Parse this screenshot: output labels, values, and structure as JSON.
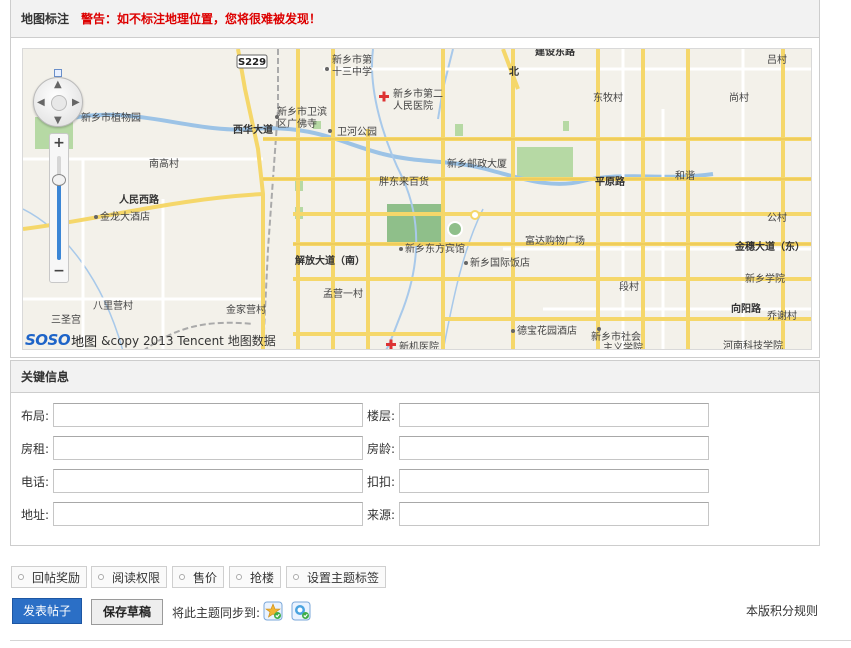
{
  "map_section": {
    "title": "地图标注",
    "warning": "警告：如不标注地理位置，您将很难被发现！",
    "logo_brand": "SOSO",
    "logo_suffix": "地图",
    "copyright": "&copy 2013 Tencent 地图数据",
    "labels": {
      "s229": "S229",
      "xinxiang_13": "新乡市第十三中学",
      "xinxiang_13_line1": "新乡市第",
      "xinxiang_13_line2": "十三中学",
      "hospital2_line1": "新乡市第二",
      "hospital2_line2": "人民医院",
      "jianshe_road": "建设东路",
      "bei": "北",
      "lv_cun": "吕村",
      "zhiwuyuan": "新乡市植物园",
      "weibin_line1": "新乡市卫滨",
      "weibin_line2": "区广佛寺",
      "weihe_park": "卫河公园",
      "dongmu": "东牧村",
      "shang_cun": "尚村",
      "nangao": "南高村",
      "xihua_dadao": "西华大道",
      "post_building": "新乡邮政大厦",
      "pangdonglai": "胖东来百货",
      "pingyuan_road": "平原路",
      "hexie": "和谐",
      "renmin_road": "人民西路",
      "jinlong_hotel": "金龙大酒店",
      "gong_cun": "公村",
      "fuda": "富达购物广场",
      "dongfang_hotel": "新乡东方宾馆",
      "jinsui_road": "金穗大道（东）",
      "guoji_hotel": "新乡国际饭店",
      "jiefang_dadao": "解放大道（南）",
      "xinxiang_college": "新乡学院",
      "duan_cun": "段村",
      "baying": "八里营村",
      "jinjia": "金家营村",
      "mengying": "孟营一村",
      "xiangyang_road": "向阳路",
      "qiaoxie": "乔谢村",
      "sansheng": "三圣宫",
      "debao_hotel": "德宝花园酒店",
      "shehui_line1": "新乡市社会",
      "shehui_line2": "主义学院",
      "xinji_hospital": "新机医院",
      "henan_tech": "河南科技学院"
    }
  },
  "info_section": {
    "title": "关键信息",
    "fields": [
      {
        "label": "布局:",
        "value": ""
      },
      {
        "label": "楼层:",
        "value": ""
      },
      {
        "label": "房租:",
        "value": ""
      },
      {
        "label": "房龄:",
        "value": ""
      },
      {
        "label": "电话:",
        "value": ""
      },
      {
        "label": "扣扣:",
        "value": ""
      },
      {
        "label": "地址:",
        "value": ""
      },
      {
        "label": "来源:",
        "value": ""
      }
    ]
  },
  "option_tabs": [
    "回帖奖励",
    "阅读权限",
    "售价",
    "抢楼",
    "设置主题标签"
  ],
  "actions": {
    "submit": "发表帖子",
    "save_draft": "保存草稿",
    "sync_text": "将此主题同步到:",
    "rules": "本版积分规则"
  },
  "colors": {
    "warning": "#dd0000",
    "submit_bg": "#2b6fc6",
    "road_major": "#f5d76a",
    "water": "#9cc3e6",
    "park": "#b6d9a4"
  },
  "icons": {
    "sync_1": "weibo-star-icon",
    "sync_2": "qzone-icon"
  }
}
